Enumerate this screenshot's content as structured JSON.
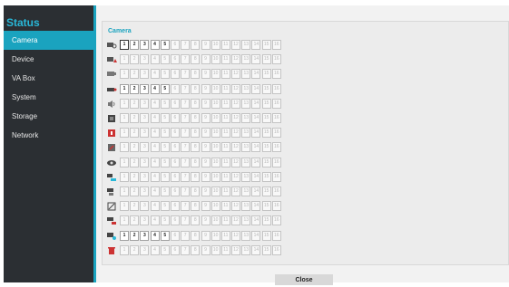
{
  "sidebar": {
    "title": "Status",
    "items": [
      {
        "label": "Camera",
        "active": true
      },
      {
        "label": "Device",
        "active": false
      },
      {
        "label": "VA Box",
        "active": false
      },
      {
        "label": "System",
        "active": false
      },
      {
        "label": "Storage",
        "active": false
      },
      {
        "label": "Network",
        "active": false
      }
    ]
  },
  "panel": {
    "title": "Camera",
    "channels": [
      "1",
      "2",
      "3",
      "4",
      "5",
      "6",
      "7",
      "8",
      "9",
      "10",
      "11",
      "12",
      "13",
      "14",
      "15",
      "16"
    ],
    "rows": [
      {
        "icon": "camera-settings-icon",
        "active": [
          1,
          2,
          3,
          4,
          5
        ],
        "selected": 1
      },
      {
        "icon": "camera-warning-icon",
        "active": []
      },
      {
        "icon": "camera-lens-icon",
        "active": []
      },
      {
        "icon": "camera-record-icon",
        "active": [
          1,
          2,
          3,
          4,
          5
        ]
      },
      {
        "icon": "speaker-icon",
        "active": []
      },
      {
        "icon": "film-icon",
        "active": []
      },
      {
        "icon": "alarm-icon",
        "active": []
      },
      {
        "icon": "motion-icon",
        "active": []
      },
      {
        "icon": "camera-dome-icon",
        "active": []
      },
      {
        "icon": "camera-network-icon",
        "active": []
      },
      {
        "icon": "camera-event-icon",
        "active": []
      },
      {
        "icon": "camera-tamper-icon",
        "active": []
      },
      {
        "icon": "camera-lost-icon",
        "active": []
      },
      {
        "icon": "camera-schedule-icon",
        "active": [
          1,
          2,
          3,
          4,
          5
        ]
      },
      {
        "icon": "trash-icon",
        "active": []
      }
    ]
  },
  "footer": {
    "close_label": "Close"
  },
  "colors": {
    "accent": "#1aa3bf",
    "sidebar_bg": "#2b2f33",
    "title": "#29b8d8"
  }
}
